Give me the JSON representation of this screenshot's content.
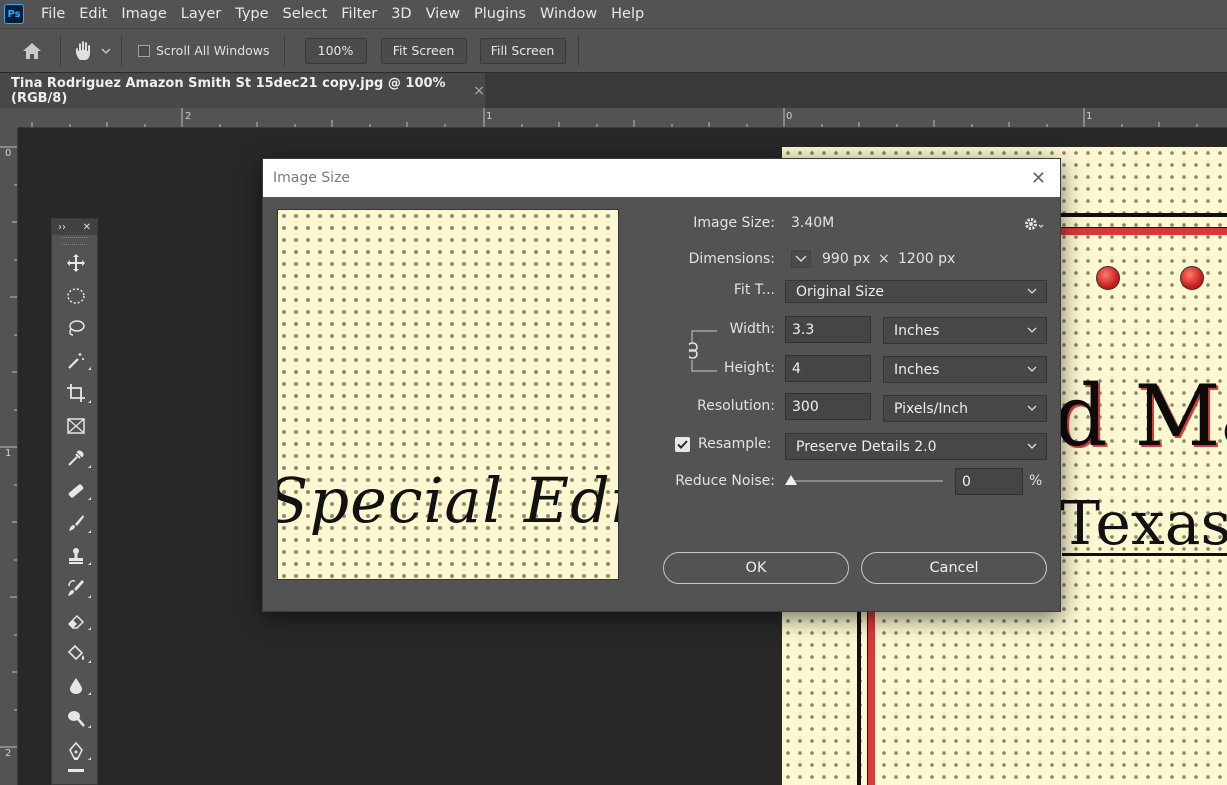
{
  "app": {
    "logo_text": "Ps"
  },
  "menu": [
    "File",
    "Edit",
    "Image",
    "Layer",
    "Type",
    "Select",
    "Filter",
    "3D",
    "View",
    "Plugins",
    "Window",
    "Help"
  ],
  "options": {
    "scroll_all_windows": "Scroll All Windows",
    "zoom_100": "100%",
    "fit_screen": "Fit Screen",
    "fill_screen": "Fill Screen"
  },
  "tab": {
    "title": "Tina Rodriguez Amazon Smith St 15dec21 copy.jpg @ 100% (RGB/8)",
    "close": "×"
  },
  "ruler": {
    "top_labels": [
      "2",
      "1",
      "0",
      "1"
    ],
    "left_labels": [
      "0",
      "1",
      "2"
    ]
  },
  "document": {
    "big_text": "d Ma",
    "sub_text": "Texas I"
  },
  "tools_panel": {
    "collapse": "››",
    "close": "✕"
  },
  "dialog": {
    "title": "Image Size",
    "close": "✕",
    "preview_text": "Special Edition",
    "image_size_label": "Image Size:",
    "image_size_value": "3.40M",
    "dimensions_label": "Dimensions:",
    "dim_width": "990 px",
    "dim_times": "×",
    "dim_height": "1200 px",
    "fit_to_label": "Fit T...",
    "fit_to_value": "Original Size",
    "width_label": "Width:",
    "width_value": "3.3",
    "width_unit": "Inches",
    "height_label": "Height:",
    "height_value": "4",
    "height_unit": "Inches",
    "resolution_label": "Resolution:",
    "resolution_value": "300",
    "resolution_unit": "Pixels/Inch",
    "resample_label": "Resample:",
    "resample_value": "Preserve Details 2.0",
    "reduce_noise_label": "Reduce Noise:",
    "reduce_noise_value": "0",
    "reduce_noise_unit": "%",
    "ok": "OK",
    "cancel": "Cancel"
  },
  "colors": {
    "ui_panel": "#535353",
    "canvas_bg": "#282828",
    "paper": "#fdf8d2",
    "accent_red": "#d83a3a"
  }
}
